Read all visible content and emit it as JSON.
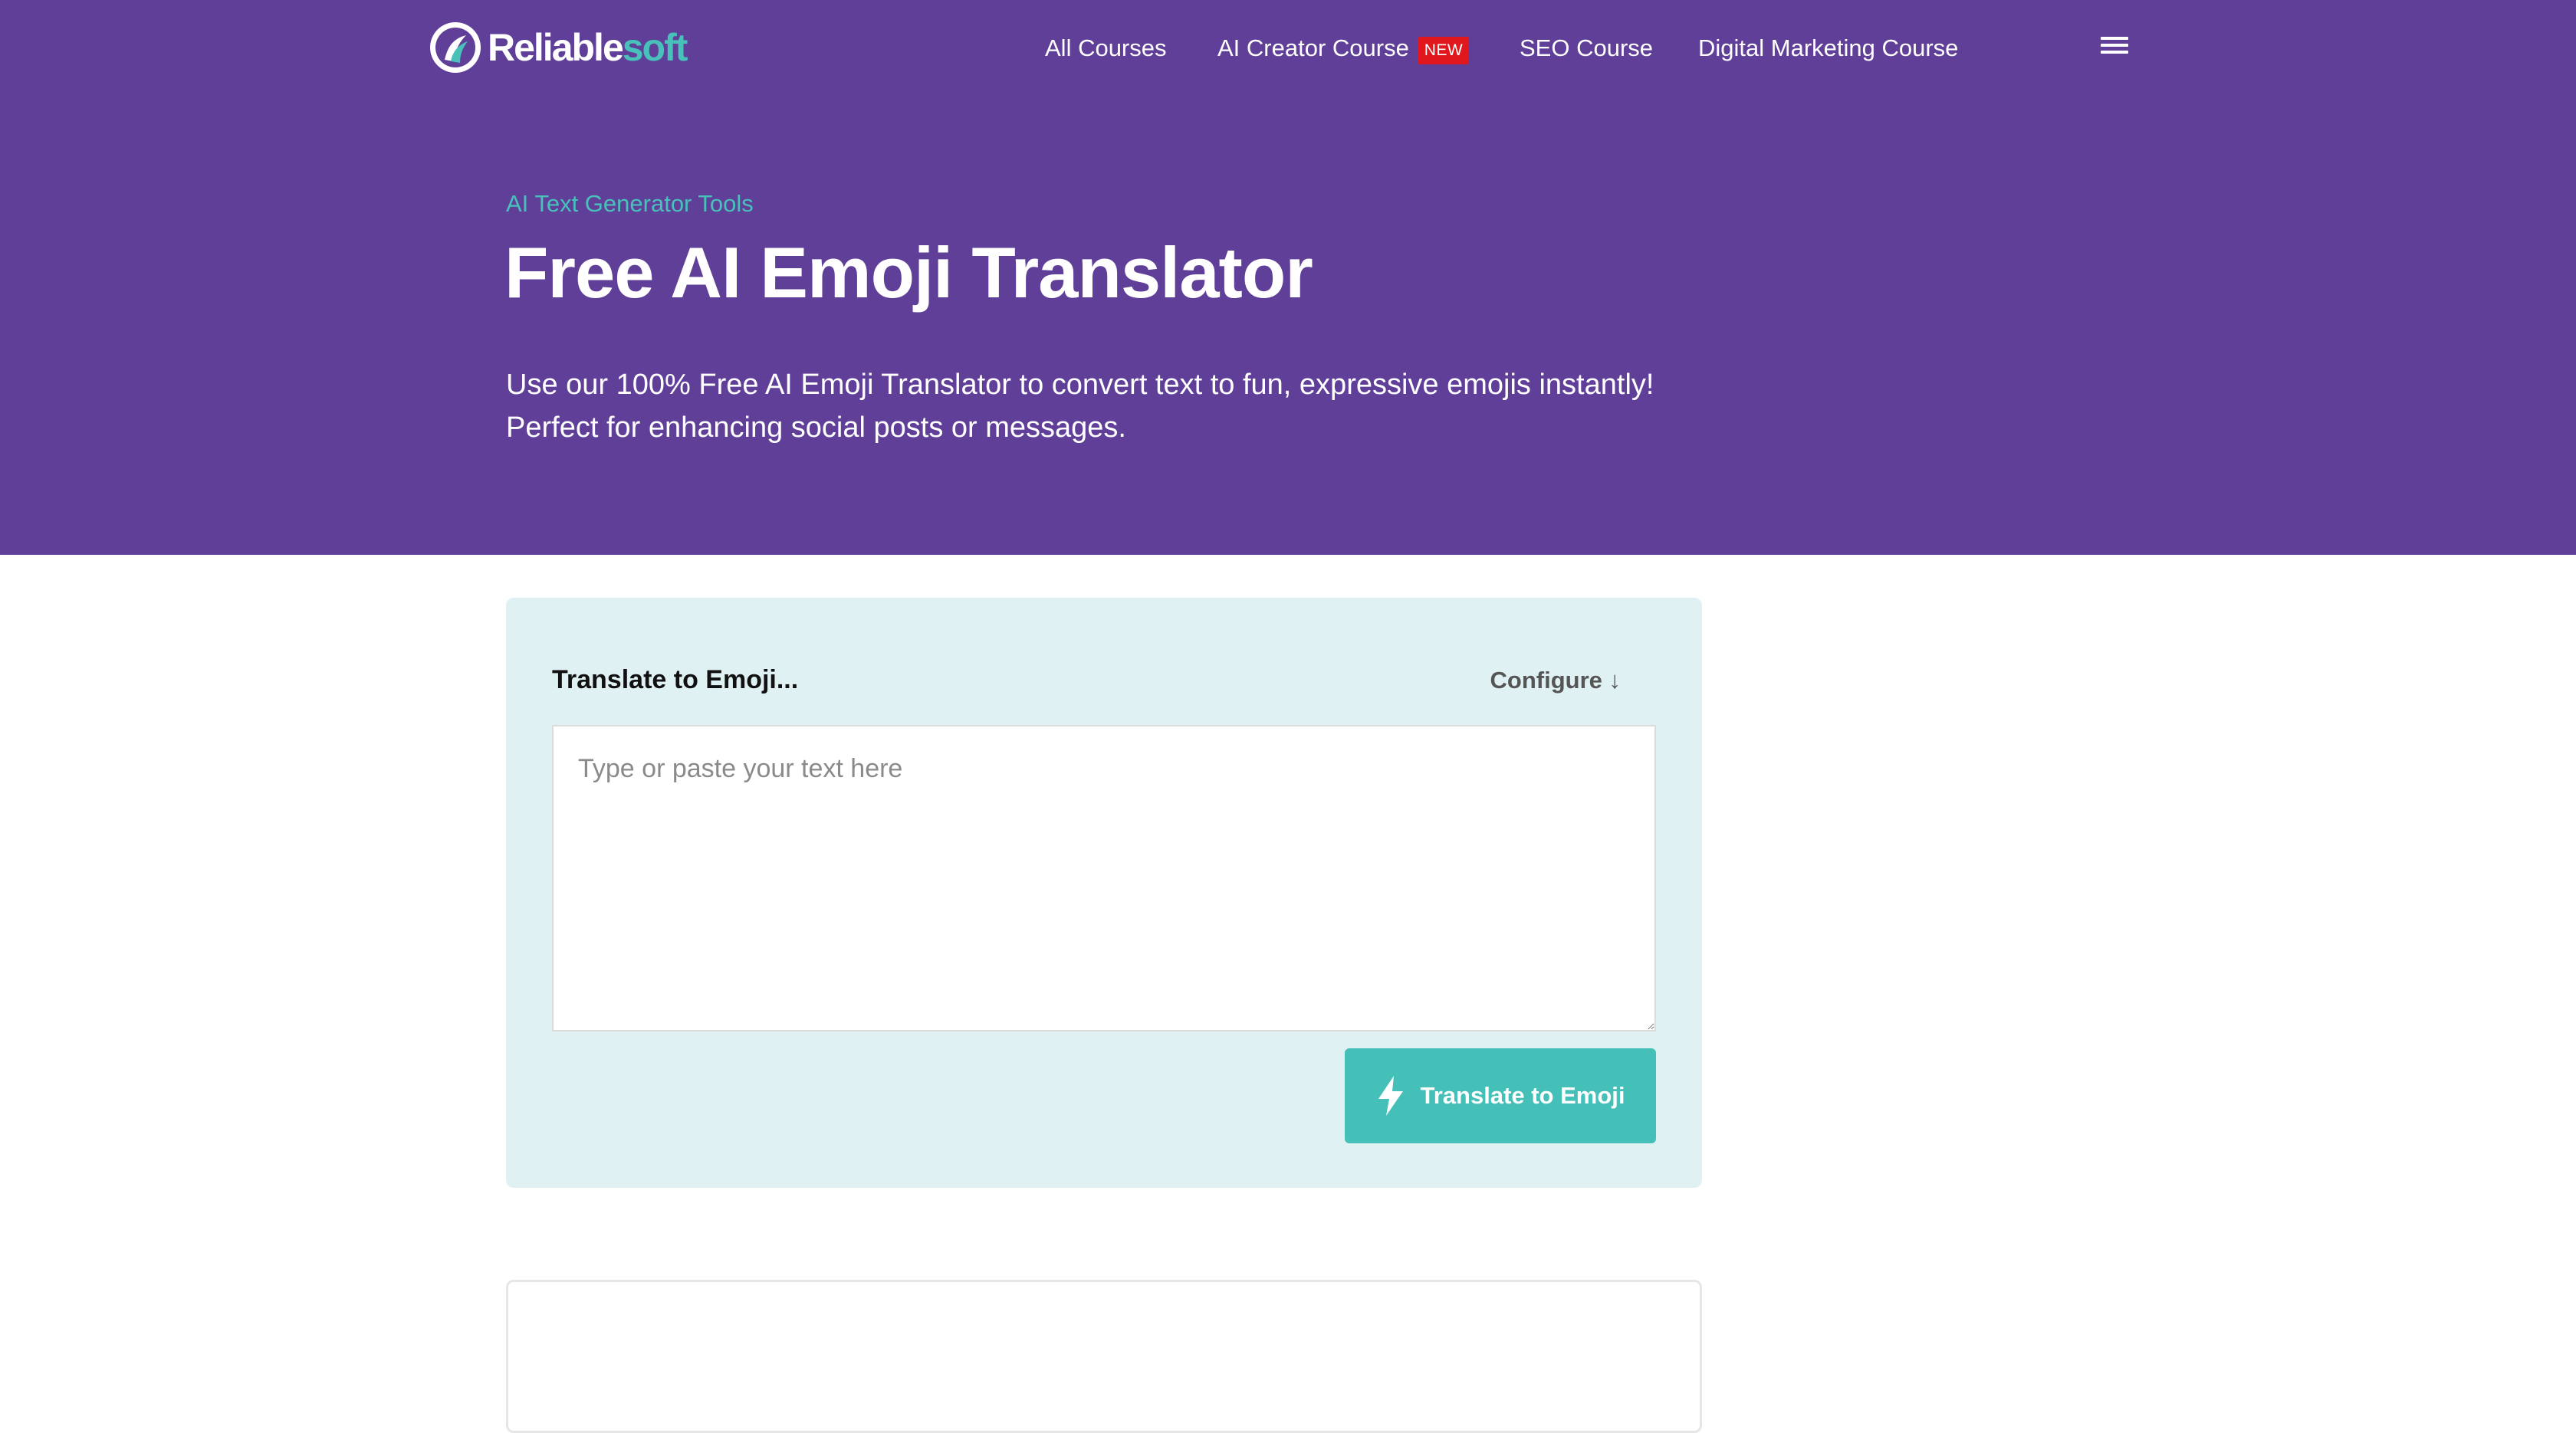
{
  "header": {
    "logo": {
      "part1": "Reliable",
      "part2": "soft"
    },
    "nav": [
      {
        "label": "All Courses"
      },
      {
        "label": "AI Creator Course",
        "badge": "NEW"
      },
      {
        "label": "SEO Course"
      },
      {
        "label": "Digital Marketing Course"
      }
    ],
    "menu_icon": "hamburger-menu-icon"
  },
  "hero": {
    "eyebrow": "AI Text Generator Tools",
    "title": "Free AI Emoji Translator",
    "lead_line1": "Use our 100% Free AI Emoji Translator to convert text to fun, expressive emojis instantly!",
    "lead_line2": "Perfect for enhancing social posts or messages."
  },
  "tool": {
    "label": "Translate to Emoji...",
    "configure": "Configure ↓",
    "input_placeholder": "Type or paste your text here",
    "input_value": "",
    "button_label": "Translate to Emoji",
    "button_icon": "lightning-bolt-icon"
  },
  "colors": {
    "hero_bg": "#603f98",
    "accent": "#48c1bb",
    "card_bg": "#e0f1f3",
    "badge": "#e0181d"
  }
}
